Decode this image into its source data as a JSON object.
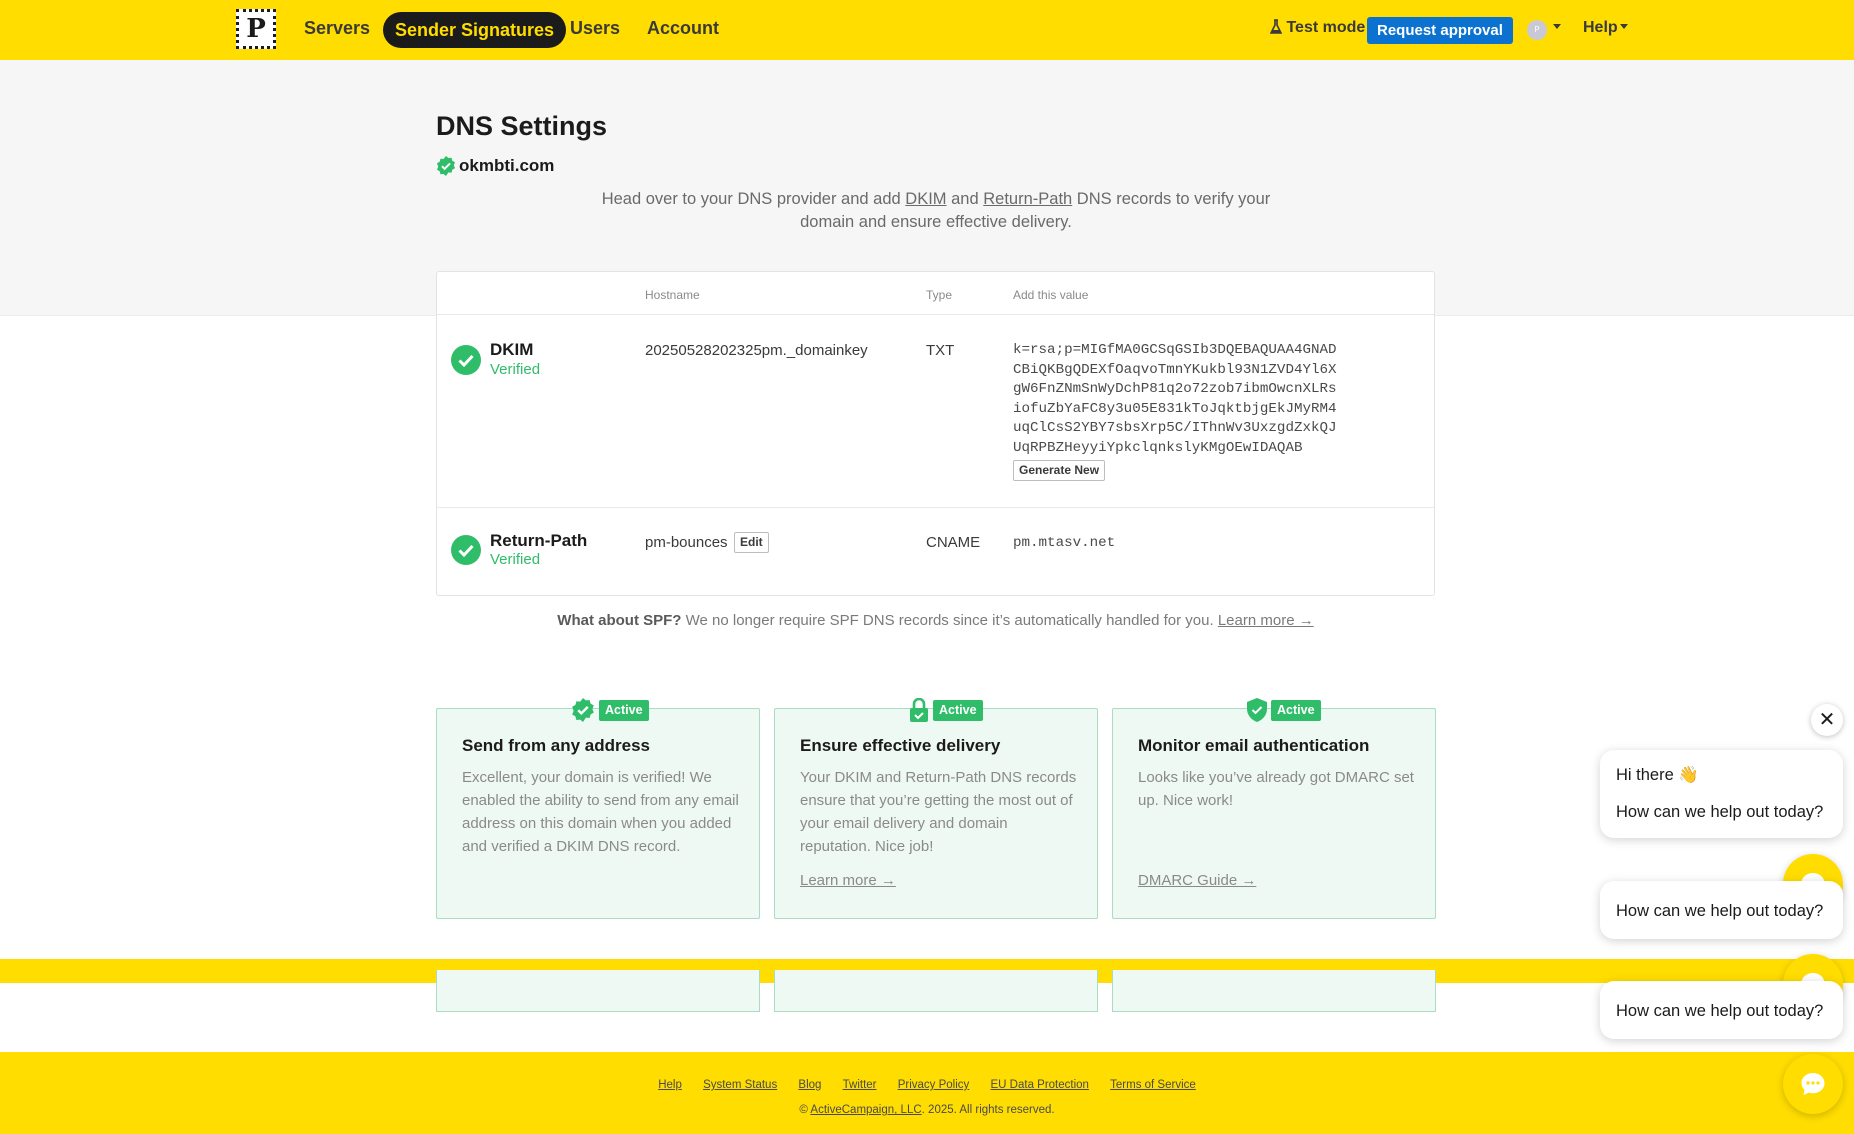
{
  "nav": {
    "logo_letter": "P",
    "items": [
      "Servers",
      "Sender Signatures",
      "Users",
      "Account"
    ],
    "active": "Sender Signatures",
    "test_mode": "Test mode",
    "request_approval": "Request approval",
    "avatar_letter": "P",
    "help": "Help"
  },
  "header": {
    "title": "DNS Settings",
    "domain": "okmbti.com",
    "intro_pre": "Head over to your DNS provider and add ",
    "intro_dkim": "DKIM",
    "intro_and": " and ",
    "intro_rp": "Return-Path",
    "intro_post": " DNS records to verify your domain and ensure effective delivery."
  },
  "table": {
    "columns": [
      "Hostname",
      "Type",
      "Add this value"
    ],
    "rows": [
      {
        "name": "DKIM",
        "status": "Verified",
        "hostname": "20250528202325pm._domainkey",
        "type": "TXT",
        "value": "k=rsa;p=MIGfMA0GCSqGSIb3DQEBAQUAA4GNAD\nCBiQKBgQDEXfOaqvoTmnYKukbl93N1ZVD4Yl6X\ngW6FnZNmSnWyDchP81q2o72zob7ibmOwcnXLRs\niofuZbYaFC8y3u05E831kToJqktbjgEkJMyRM4\nuqClCsS2YBY7sbsXrp5C/IThnWv3UxzgdZxkQJ\nUqRPBZHeyyiYpkclqnkslyKMgOEwIDAQAB",
        "action": "Generate New"
      },
      {
        "name": "Return-Path",
        "status": "Verified",
        "hostname": "pm-bounces",
        "edit": "Edit",
        "type": "CNAME",
        "value": "pm.mtasv.net"
      }
    ]
  },
  "spf": {
    "bold": "What about SPF?",
    "text": " We no longer require SPF DNS records since it’s automatically handled for you. ",
    "link": "Learn more →"
  },
  "features": [
    {
      "badge": "Active",
      "icon": "verified-badge-icon",
      "title": "Send from any address",
      "body": "Excellent, your domain is verified! We enabled the ability to send from any email address on this domain when you added and verified a DKIM DNS record.",
      "link": ""
    },
    {
      "badge": "Active",
      "icon": "lock-icon",
      "title": "Ensure effective delivery",
      "body": "Your DKIM and Return-Path DNS records ensure that you’re getting the most out of your email delivery and domain reputation. Nice job!",
      "link": "Learn more →"
    },
    {
      "badge": "Active",
      "icon": "shield-check-icon",
      "title": "Monitor email authentication",
      "body": "Looks like you’ve already got DMARC set up. Nice work!",
      "link": "DMARC Guide →"
    }
  ],
  "footer": {
    "links": [
      "Help",
      "System Status",
      "Blog",
      "Twitter",
      "Privacy Policy",
      "EU Data Protection",
      "Terms of Service"
    ],
    "copy_pre": "© ",
    "copy_link": "ActiveCampaign, LLC",
    "copy_post": ". 2025. All rights reserved."
  },
  "chat": {
    "greeting": "Hi there 👋",
    "prompt": "How can we help out today?",
    "close": "✕"
  },
  "colors": {
    "brand_yellow": "#ffdd00",
    "verified_green": "#2fbd6a",
    "primary_blue": "#0b72cf"
  }
}
